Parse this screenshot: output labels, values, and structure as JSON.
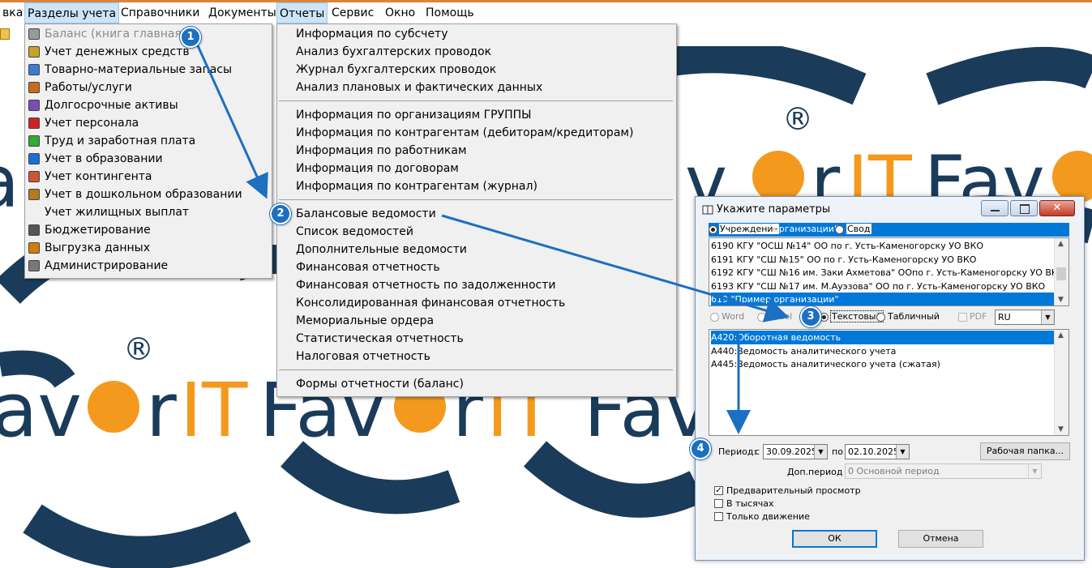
{
  "menubar": {
    "items": [
      "вка",
      "Разделы учета",
      "Справочники",
      "Документы",
      "Отчеты",
      "Сервис",
      "Окно",
      "Помощь"
    ]
  },
  "background_logo": {
    "brand_text": "FavorIT",
    "text_colors": {
      "dark": "#1a3c5a",
      "orange": "#f39a1e"
    },
    "registered_mark": "®"
  },
  "sections_menu": {
    "items": [
      {
        "label": "Баланс (книга главная)",
        "icon": "ledger-icon",
        "disabled": true
      },
      {
        "label": "Учет денежных средств",
        "icon": "money-icon"
      },
      {
        "label": "Товарно-материальные запасы",
        "icon": "inventory-icon"
      },
      {
        "label": "Работы/услуги",
        "icon": "services-icon"
      },
      {
        "label": "Долгосрочные активы",
        "icon": "assets-icon"
      },
      {
        "label": "Учет персонала",
        "icon": "personnel-icon"
      },
      {
        "label": "Труд и заработная плата",
        "icon": "salary-icon"
      },
      {
        "label": "Учет в образовании",
        "icon": "education-icon"
      },
      {
        "label": "Учет контингента",
        "icon": "contingent-icon"
      },
      {
        "label": "Учет в дошкольном образовании",
        "icon": "preschool-icon"
      },
      {
        "label": "Учет жилищных выплат",
        "icon": ""
      },
      {
        "label": "Бюджетирование",
        "icon": "budget-icon"
      },
      {
        "label": "Выгрузка данных",
        "icon": "export-icon"
      },
      {
        "label": "Администрирование",
        "icon": "admin-icon"
      }
    ]
  },
  "reports_menu": {
    "group1": [
      "Информация по субсчету",
      "Анализ бухгалтерских проводок",
      "Журнал бухгалтерских проводок",
      "Анализ плановых и фактических данных"
    ],
    "group2": [
      "Информация по организациям ГРУППЫ",
      "Информация по контрагентам (дебиторам/кредиторам)",
      "Информация по работникам",
      "Информация по договорам",
      "Информация по контрагентам (журнал)"
    ],
    "group3": [
      "Балансовые ведомости",
      "Список ведомостей",
      "Дополнительные ведомости",
      "Финансовая отчетность",
      "Финансовая отчетность по задолженности",
      "Консолидированная финансовая отчетность",
      "Мемориальные ордера",
      "Статистическая отчетность",
      "Налоговая отчетность"
    ],
    "group4": [
      "Формы отчетности (баланс)"
    ]
  },
  "dialog": {
    "title": "Укажите параметры",
    "scope": {
      "option1": "Учреждение",
      "selected_org": "организации\"",
      "option2": "Свод"
    },
    "org_list": [
      "6190 КГУ \"ОСШ №14\" ОО по г. Усть-Каменогорску УО ВКО",
      "6191 КГУ \"СШ №15\" ОО по г. Усть-Каменогорску УО ВКО",
      "6192 КГУ \"СШ №16 им. Заки Ахметова\" ООпо г. Усть-Каменогорску УО ВКО",
      "6193 КГУ \"СШ №17 им. М.Ауэзова\" ОО по г. Усть-Каменогорску УО ВКО",
      "619 \"Пример организации\""
    ],
    "format": {
      "word": "Word",
      "excel": "Excel",
      "text": "Текстовый",
      "table": "Табличный",
      "pdf": "PDF",
      "lang": "RU"
    },
    "reports": [
      "А420:Оборотная ведомость",
      "А440:Ведомость аналитического учета",
      "А445:Ведомость аналитического учета (сжатая)"
    ],
    "period_label": "Период:",
    "from_label": "с",
    "date_from": "30.09.2025",
    "to_label": "по",
    "date_to": "02.10.2025",
    "workdir_button": "Рабочая папка...",
    "extra_period_label": "Доп.период",
    "extra_period_value": "0 Основной период",
    "checkbox_preview": "Предварительный просмотр",
    "checkbox_thousands": "В тысячах",
    "checkbox_movement": "Только движение",
    "ok": "ОК",
    "cancel": "Отмена"
  },
  "badges": [
    "1",
    "2",
    "3",
    "4"
  ],
  "colors": {
    "accent": "#1d6fc2",
    "selection": "#0078d7",
    "menu_bg": "#f0f0f0"
  }
}
